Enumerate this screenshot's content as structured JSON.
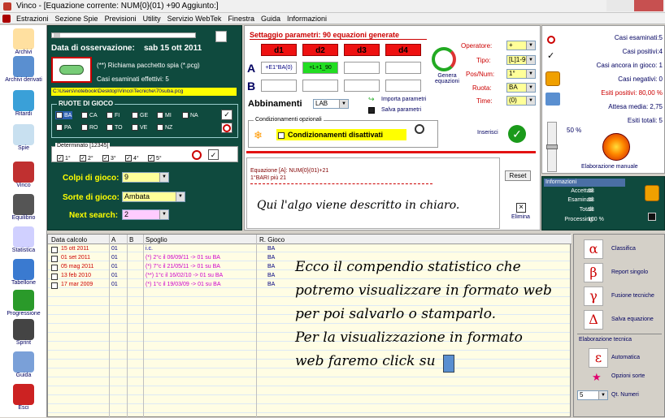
{
  "window": {
    "title": "Vinco - [Equazione corrente: NUM{0}(01) +90 Aggiunto:]"
  },
  "menu": [
    "Estrazioni",
    "Sezione Spie",
    "Previsioni",
    "Utility",
    "Servizio WebTek",
    "Finestra",
    "Guida",
    "Informazioni"
  ],
  "sidebar": [
    {
      "label": "Archivi",
      "icon": "pencil-icon"
    },
    {
      "label": "Archivi derivati",
      "icon": "book-icon"
    },
    {
      "label": "Ritardi",
      "icon": "clock-icon"
    },
    {
      "label": "Spie",
      "icon": "target-icon"
    },
    {
      "label": "Vinco",
      "icon": "vinco-icon"
    },
    {
      "label": "Equilibrio",
      "icon": "scales-icon"
    },
    {
      "label": "Statistica",
      "icon": "chart-icon"
    },
    {
      "label": "Tabellone",
      "icon": "calendar-icon"
    },
    {
      "label": "Progressione",
      "icon": "dollar-icon"
    },
    {
      "label": "Sprint",
      "icon": "sprint-icon"
    },
    {
      "label": "Guida",
      "icon": "guide-icon"
    },
    {
      "label": "Esci",
      "icon": "exit-icon"
    }
  ],
  "left_panel": {
    "obs_label": "Data di osservazione:",
    "obs_date": "sab 15 ott 2011",
    "spy_note": "(**) Richiama pacchetto spia (*.pcg)",
    "cases_label": "Casi esaminati effettivi: 5",
    "path": "C:\\Users\\notebook\\Desktop\\Vinco\\Tecniche\\70suba.pcg",
    "ruote_title": "RUOTE DI GIOCO",
    "ruote": [
      {
        "label": "BA",
        "checked": true
      },
      {
        "label": "CA",
        "checked": false
      },
      {
        "label": "FI",
        "checked": false
      },
      {
        "label": "GE",
        "checked": false
      },
      {
        "label": "MI",
        "checked": false
      },
      {
        "label": "NA",
        "checked": false
      },
      {
        "label": "PA",
        "checked": false
      },
      {
        "label": "RO",
        "checked": false
      },
      {
        "label": "TO",
        "checked": false
      },
      {
        "label": "VE",
        "checked": false
      },
      {
        "label": "NZ",
        "checked": false
      }
    ],
    "det_title": "Determinato [12345]",
    "det": [
      {
        "label": "1°",
        "checked": true
      },
      {
        "label": "2°",
        "checked": true
      },
      {
        "label": "3°",
        "checked": true
      },
      {
        "label": "4°",
        "checked": true
      },
      {
        "label": "5°",
        "checked": true
      }
    ],
    "colpi_label": "Colpi di gioco:",
    "colpi_value": "9",
    "sorte_label": "Sorte di gioco:",
    "sorte_value": "Ambata",
    "next_label": "Next search:",
    "next_value": "2"
  },
  "params": {
    "title": "Settaggio parametri: 90 equazioni generate",
    "d_headers": [
      "d1",
      "d2",
      "d3",
      "d4"
    ],
    "row_a_label": "A",
    "row_b_label": "B",
    "a_values": [
      "+E1°BA(0)",
      "+L+1_90",
      "",
      ""
    ],
    "abbinamenti_label": "Abbinamenti",
    "abbinamenti_value": "LAB",
    "import_label": "Importa parametri",
    "save_label": "Salva parametri",
    "genera_label": "Genera equazioni",
    "operatore_label": "Operatore:",
    "operatore_value": "+",
    "tipo_label": "Tipo:",
    "tipo_value": "[L]1-90",
    "pos_label": "Pos/Num:",
    "pos_value": "1°",
    "ruota_label": "Ruota:",
    "ruota_value": "BA",
    "tempo_label": "Time:",
    "tempo_value": "(0)",
    "cond_title": "Condizionamenti opzionali",
    "cond_value": "Condizionamenti disattivati",
    "inserisci_label": "Inserisci",
    "eq_line1": "Equazione [A]: NUM{0}(01)+21",
    "eq_line2": "1°BARI  più 21",
    "reset_label": "Reset",
    "elimina_label": "Elimina",
    "handwritten": "Qui l'algo viene descritto in chiaro."
  },
  "stats": {
    "casi_esaminati": "Casi esaminati:5",
    "casi_positivi": "Casi positivi:4",
    "casi_ancora": "Casi ancora in gioco: 1",
    "casi_negativi": "Casi negativi: 0",
    "esiti_positivi": "Esiti positivi: 80,00 %",
    "attesa_media": "Attesa media: 2,75",
    "esiti_totali": "Esiti totali: 5",
    "slider_pct": "50 %",
    "slider_level": 0.5,
    "elab_label": "Elaborazione manuale"
  },
  "info": {
    "title": "Informazioni",
    "accettati_label": "Accettati:",
    "accettati": "18",
    "esaminati_label": "Esaminati:",
    "esaminati": "18",
    "totali_label": "Totali:",
    "totali": "18",
    "processing_label": "Processing:",
    "processing": "100 %"
  },
  "list": {
    "headers": [
      "Data calcolo",
      "A",
      "B",
      "Spoglio",
      "R. Gioco"
    ],
    "rows": [
      {
        "date": "15 ott 2011",
        "a": "01",
        "b": "",
        "spoglio": "i.c.",
        "ruota": "BA",
        "color": "#cc0000",
        "spoglio_color": "#0000aa"
      },
      {
        "date": "01 set 2011",
        "a": "01",
        "b": "",
        "spoglio": "(*) 2°c il 06/09/11 -> 01 su BA",
        "ruota": "BA",
        "color": "#cc0000",
        "spoglio_color": "#cc00cc"
      },
      {
        "date": "05 mag 2011",
        "a": "01",
        "b": "",
        "spoglio": "(*) 7°c il 21/05/11 -> 01 su BA",
        "ruota": "BA",
        "color": "#cc0000",
        "spoglio_color": "#cc00cc"
      },
      {
        "date": "13 feb 2010",
        "a": "01",
        "b": "",
        "spoglio": "(**) 1°c il 16/02/10 -> 01 su BA",
        "ruota": "BA",
        "color": "#cc0000",
        "spoglio_color": "#cc00cc"
      },
      {
        "date": "17 mar 2009",
        "a": "01",
        "b": "",
        "spoglio": "(*) 1°c il 19/03/09 -> 01 su BA",
        "ruota": "BA",
        "color": "#cc0000",
        "spoglio_color": "#cc00cc"
      }
    ],
    "note_lines": [
      "Ecco il compendio statistico che",
      "potremo visualizzare in formato web",
      "per poi salvarlo o stamparlo.",
      "Per la visualizzazione in formato",
      "web faremo click su"
    ]
  },
  "tools": {
    "items": [
      {
        "glyph": "α",
        "label": "Classifica"
      },
      {
        "glyph": "β",
        "label": "Report singolo"
      },
      {
        "glyph": "γ",
        "label": "Fusione tecniche"
      },
      {
        "glyph": "Δ",
        "label": "Salva equazione"
      }
    ],
    "elab_title": "Elaborazione tecnica",
    "auto_glyph": "ε",
    "auto_label": "Automatica",
    "opzioni_label": "Opzioni sorte",
    "qt_value": "5",
    "qt_label": "Qt. Numeri"
  }
}
